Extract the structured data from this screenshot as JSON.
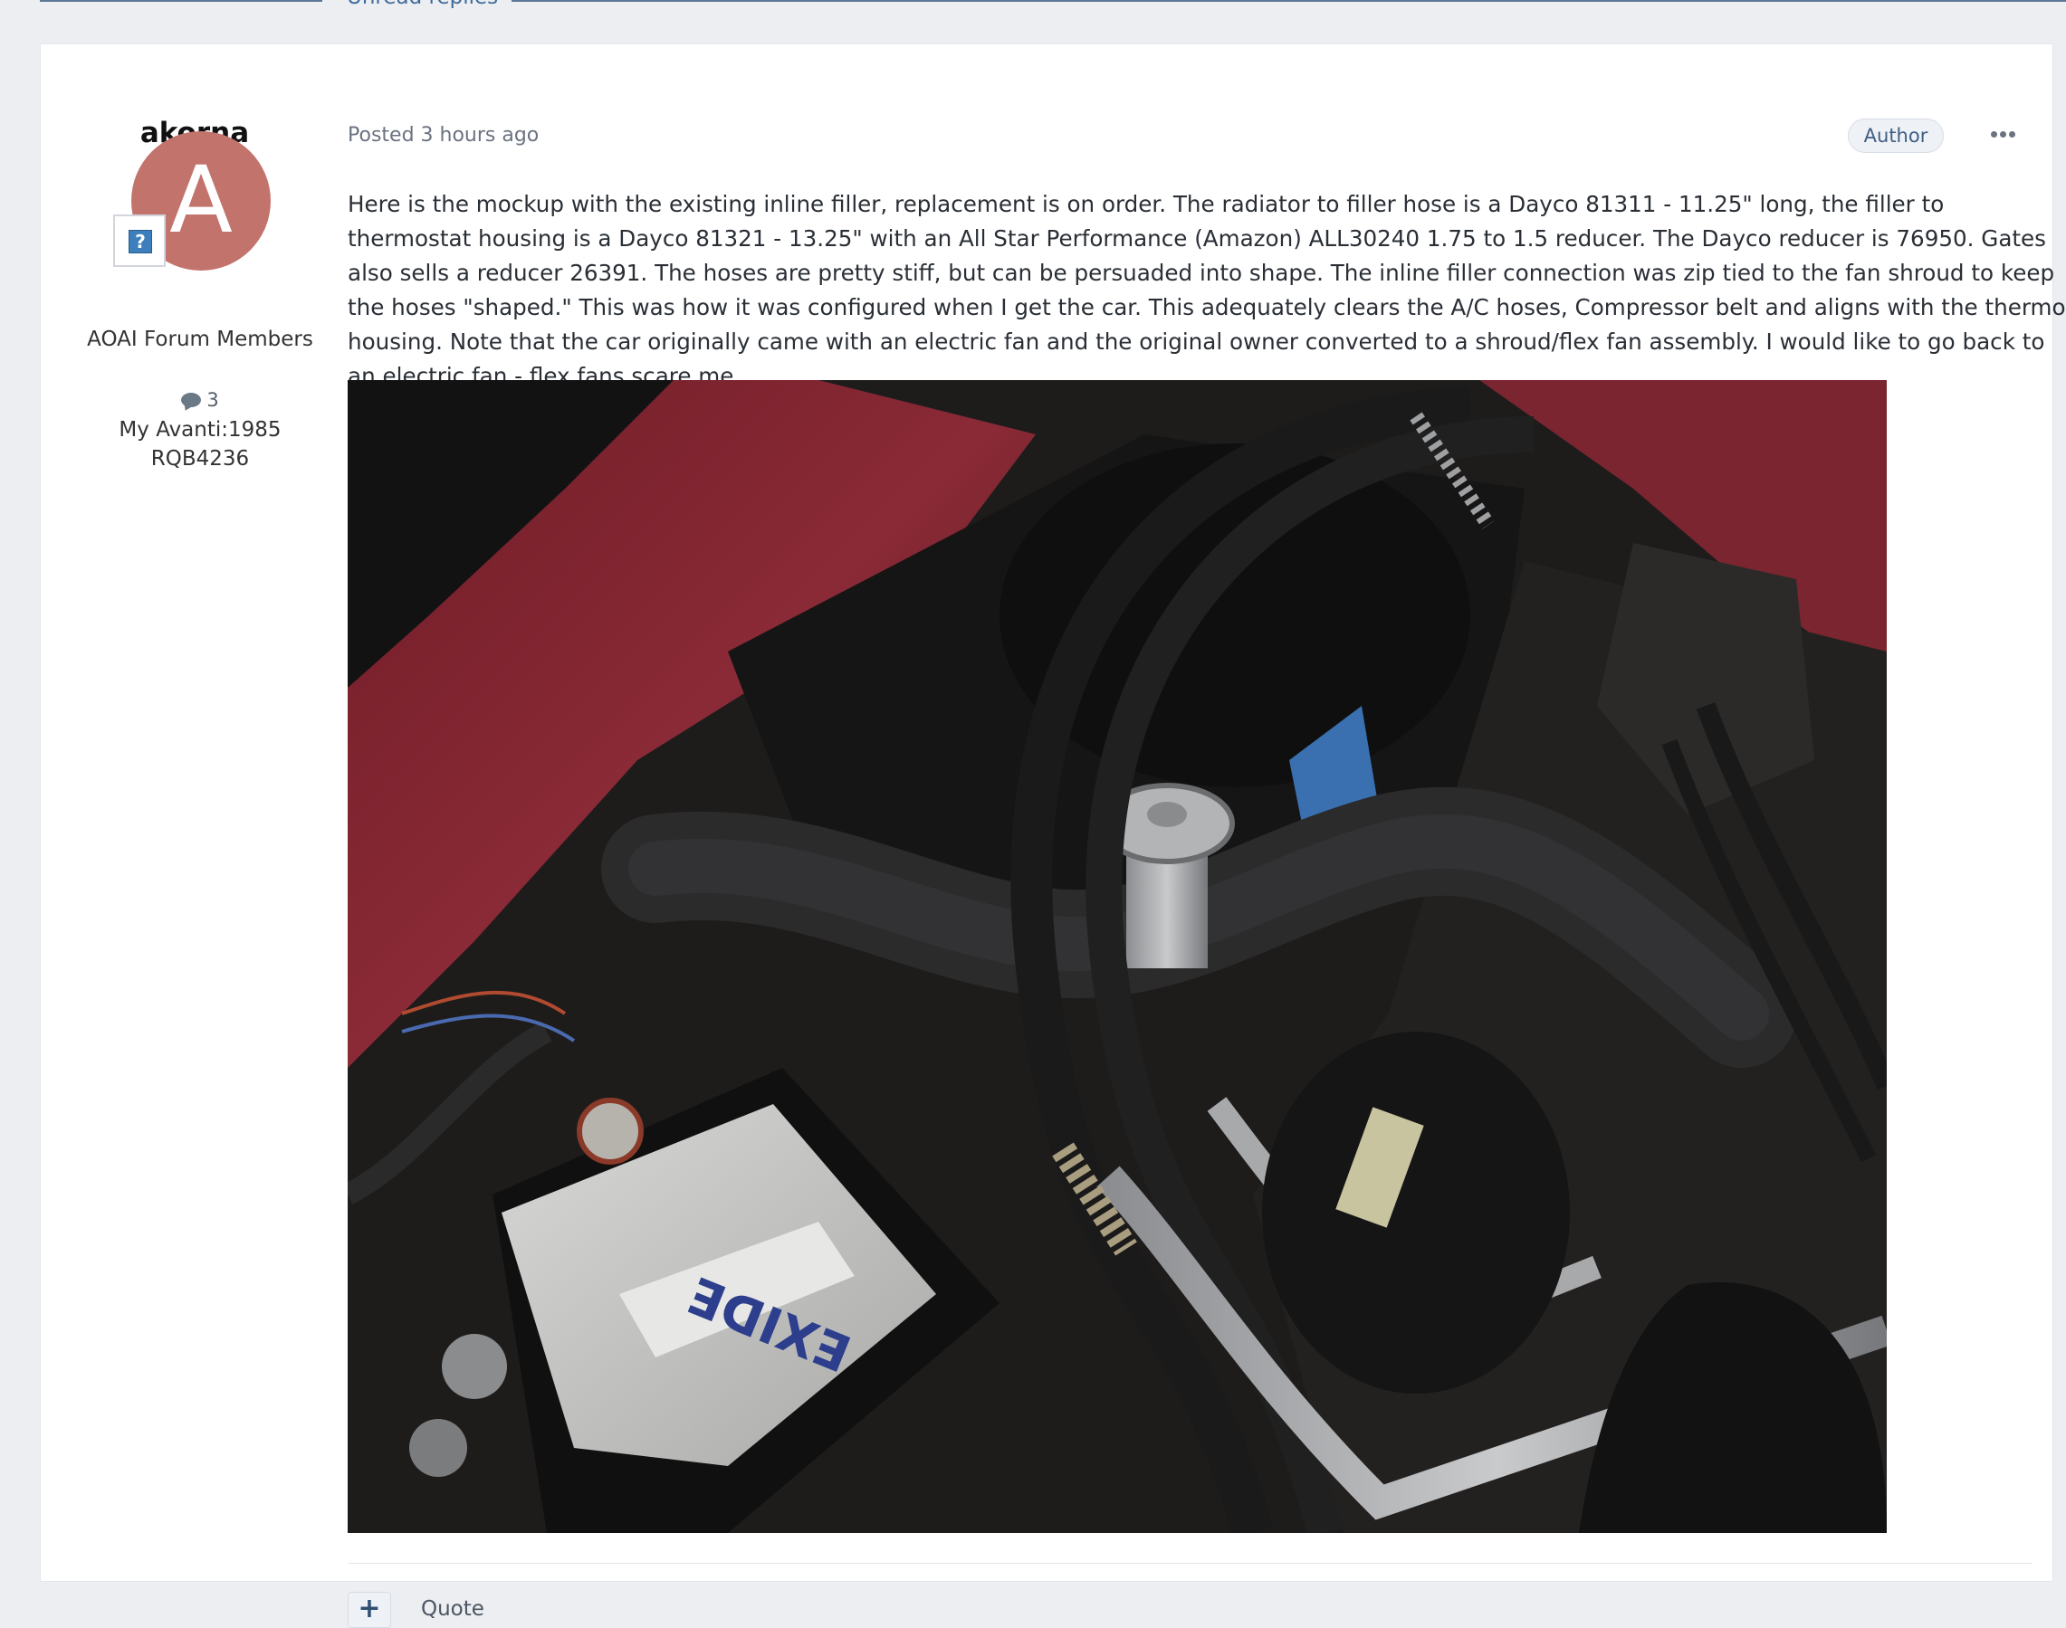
{
  "nav": {
    "unread_replies_label": "Unread replies"
  },
  "author": {
    "name": "akorna",
    "avatar_letter": "A",
    "avatar_color": "#c2736c",
    "rank_badge_glyph": "?",
    "group": "AOAI Forum Members",
    "post_count": "3",
    "profile_field_1": "My Avanti:1985",
    "profile_field_2": "RQB4236"
  },
  "post": {
    "meta": "Posted 3 hours ago",
    "author_badge": "Author",
    "body": "Here is the mockup with the existing inline filler, replacement is on order.  The radiator to filler hose is a Dayco 81311 - 11.25\" long, the filler to thermostat housing is a Dayco 81321 - 13.25\" with an All Star Performance (Amazon) ALL30240 1.75 to 1.5 reducer.  The Dayco reducer is 76950. Gates also sells a reducer 26391.  The hoses are pretty stiff, but can be persuaded into shape.  The inline filler connection was zip tied to the fan shroud to keep the hoses \"shaped.\"  This was how it was configured when I get the car.  This adequately clears the A/C hoses, Compressor belt and aligns with the thermo housing.   Note that the car originally came with an electric fan and the original owner converted to a shroud/flex fan assembly.  I would like to go back to an electric fan - flex fans scare me.",
    "image_semantic": "engine-bay-photo"
  },
  "actions": {
    "plus_label": "+",
    "quote_label": "Quote"
  },
  "colors": {
    "page_bg": "#eceef1",
    "card_bg": "#ffffff",
    "link": "#3f6b9b",
    "badge_text": "#3f5f84"
  }
}
